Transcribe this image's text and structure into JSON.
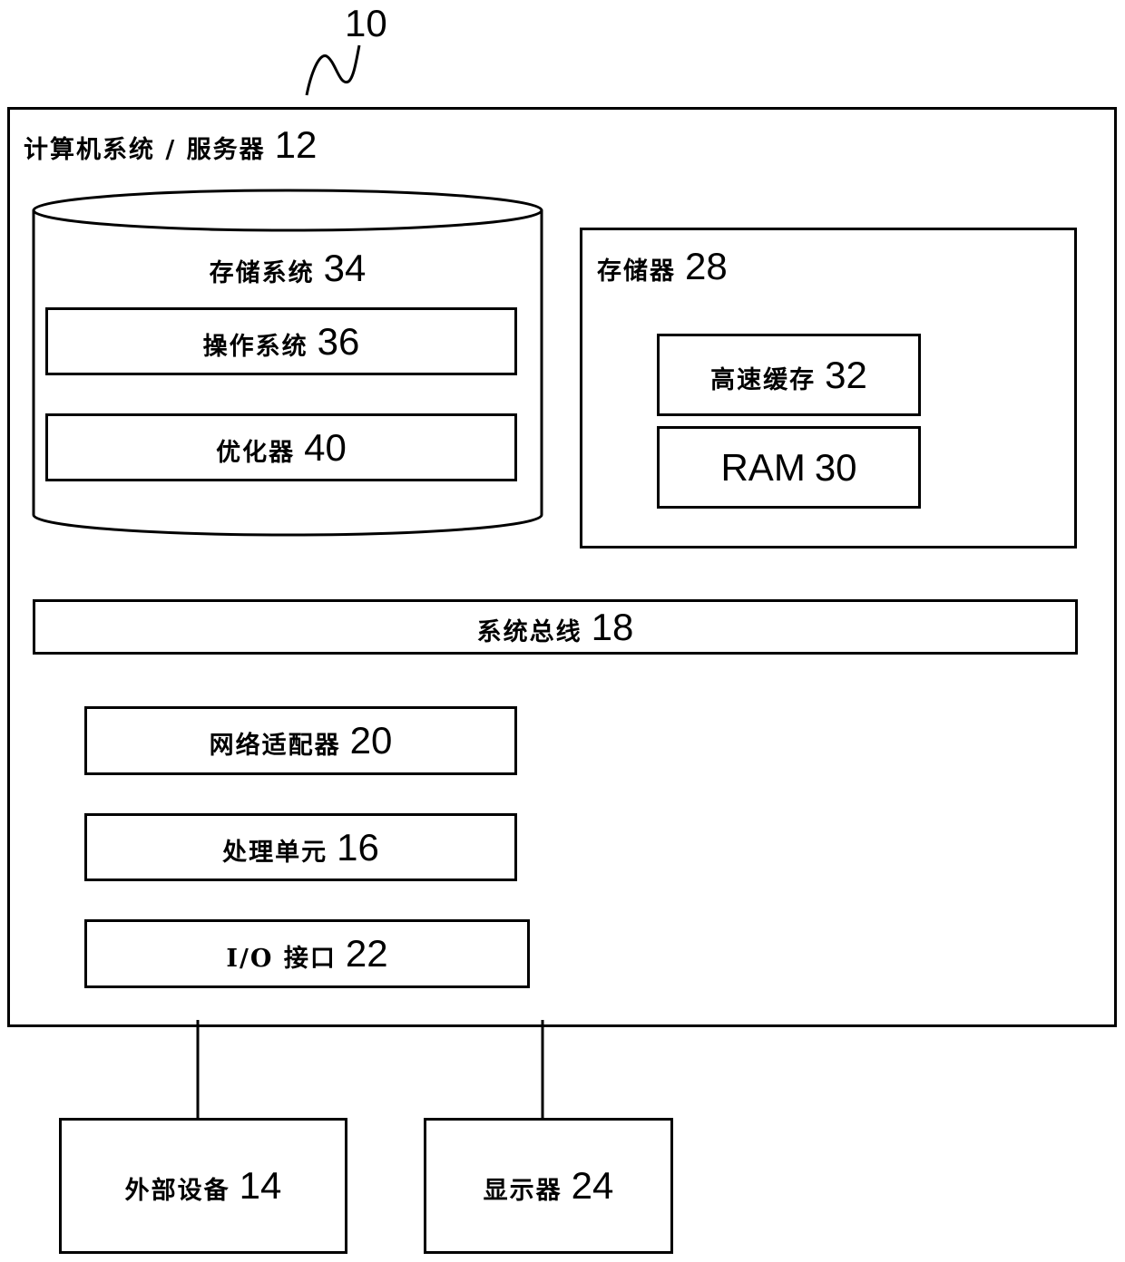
{
  "figure": {
    "ref_number": "10",
    "outer": {
      "name": "计算机系统 / 服务器",
      "ref": "12"
    },
    "storage_system": {
      "name": "存储系统",
      "ref": "34"
    },
    "operating_system": {
      "name": "操作系统",
      "ref": "36"
    },
    "optimizer": {
      "name": "优化器",
      "ref": "40"
    },
    "memory": {
      "name": "存储器",
      "ref": "28"
    },
    "cache": {
      "name": "高速缓存",
      "ref": "32"
    },
    "ram": {
      "name": "RAM",
      "ref": "30"
    },
    "system_bus": {
      "name": "系统总线",
      "ref": "18"
    },
    "network_adapter": {
      "name": "网络适配器",
      "ref": "20"
    },
    "processing_unit": {
      "name": "处理单元",
      "ref": "16"
    },
    "io_interface": {
      "name": "I/O 接口",
      "ref": "22"
    },
    "external_device": {
      "name": "外部设备",
      "ref": "14"
    },
    "display": {
      "name": "显示器",
      "ref": "24"
    }
  }
}
